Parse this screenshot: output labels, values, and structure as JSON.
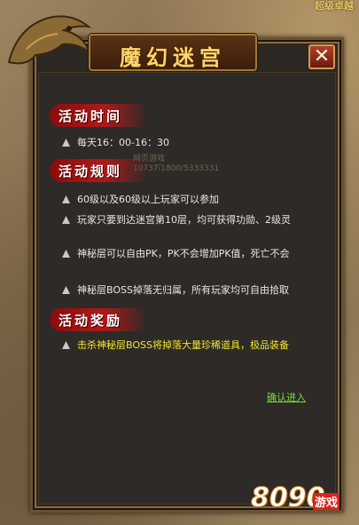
{
  "corner_text": "超级卓越",
  "title": "魔幻迷宫",
  "close_label": "✕",
  "sections": [
    {
      "heading": "活动时间",
      "items": [
        "每天16：00-16：30"
      ]
    },
    {
      "heading": "活动规则",
      "items": [
        "60级以及60级以上玩家可以参加",
        "玩家只要到达迷宫第10层，均可获得功勋、2级灵",
        "神秘层可以自由PK，PK不会增加PK值，死亡不会",
        "神秘层BOSS掉落无归属，所有玩家均可自由拾取"
      ]
    },
    {
      "heading": "活动奖励",
      "items": [
        "击杀神秘层BOSS将掉落大量珍稀道具，极品装备"
      ]
    }
  ],
  "confirm_label": "确认进入",
  "watermark_lines": [
    "网页游戏",
    "10737ï1800/5333331"
  ],
  "logo": {
    "number": "8090",
    "text": "游戏"
  },
  "colors": {
    "accent_red": "#b01818",
    "title_gold": "#ffd76a",
    "reward_yellow": "#f2e630",
    "link_green": "#7ddc3c"
  }
}
